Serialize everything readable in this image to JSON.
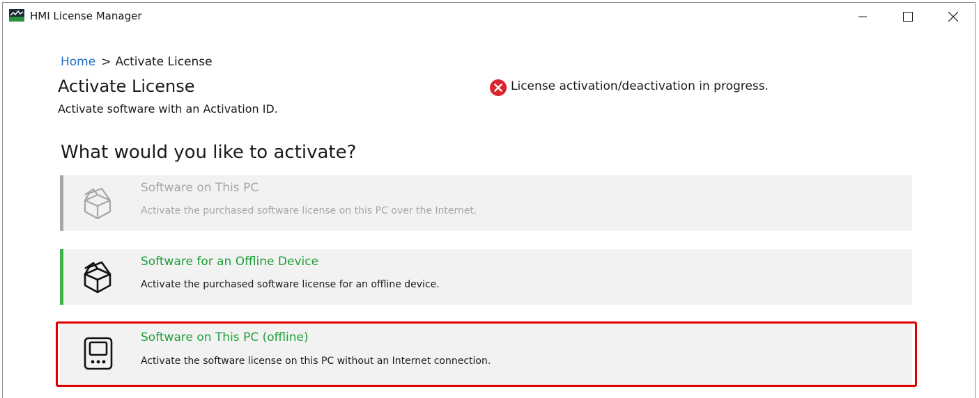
{
  "window": {
    "title": "HMI License Manager",
    "controls": {
      "minimize": "minimize-icon",
      "maximize": "maximize-icon",
      "close": "close-icon"
    }
  },
  "breadcrumb": {
    "home": "Home",
    "separator": ">",
    "current": "Activate License"
  },
  "page": {
    "title": "Activate License",
    "subtitle": "Activate software with an Activation ID."
  },
  "status": {
    "icon": "error-icon",
    "text": "License activation/deactivation in progress.",
    "color": "#d9262c"
  },
  "question": "What would you like to activate?",
  "options": [
    {
      "icon": "package-icon",
      "title": "Software on This PC",
      "description": "Activate the purchased software license on this PC over the Internet.",
      "state": "disabled",
      "accent": "#a6a6a6"
    },
    {
      "icon": "package-icon",
      "title": "Software for an Offline Device",
      "description": "Activate the purchased software license for an offline device.",
      "state": "enabled",
      "accent": "#3bb54a"
    },
    {
      "icon": "terminal-device-icon",
      "title": "Software on This PC (offline)",
      "description": "Activate the software license on this PC without an Internet connection.",
      "state": "highlighted",
      "accent": "#e00000"
    }
  ]
}
